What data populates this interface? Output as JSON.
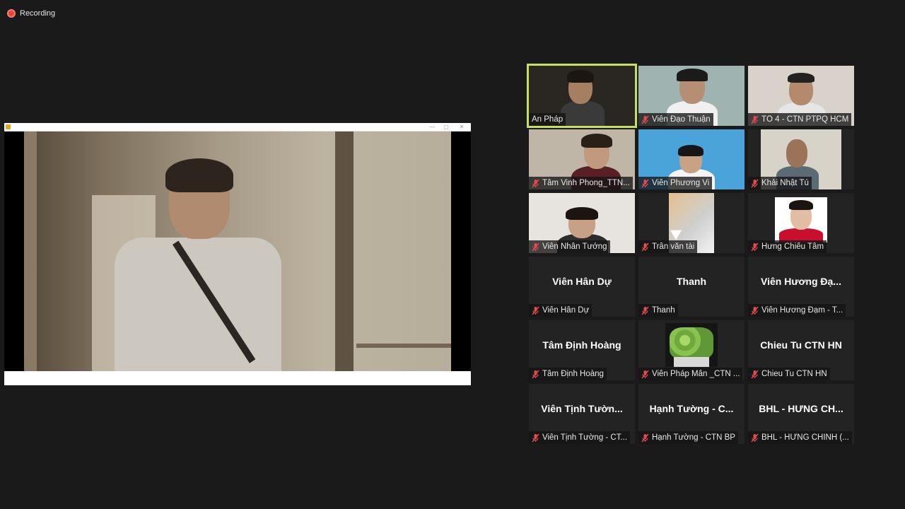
{
  "recording": {
    "label": "Recording",
    "color": "#e8443a"
  },
  "share": {
    "title_icon": "window-app-icon",
    "controls": [
      "—",
      "▢",
      "✕"
    ]
  },
  "gallery": {
    "active_border_color": "#c5e05a",
    "tiles": [
      {
        "name": "Ân Pháp",
        "muted": false,
        "video": true,
        "active": true
      },
      {
        "name": "Viên Đạo Thuận",
        "muted": true,
        "video": true
      },
      {
        "name": "TỔ 4 - CTN PTPQ HCM",
        "muted": true,
        "video": true
      },
      {
        "name": "Tâm Vinh Phong_TTN...",
        "muted": true,
        "video": true
      },
      {
        "name": "Viên Phương Vi",
        "muted": true,
        "video": true
      },
      {
        "name": "Khải Nhật Tú",
        "muted": true,
        "video": true
      },
      {
        "name": "Viên Nhân Tướng",
        "muted": true,
        "video": true
      },
      {
        "name": "Trần văn tài",
        "muted": true,
        "video": true
      },
      {
        "name": "Hưng Chiếu Tâm",
        "muted": true,
        "video": true
      },
      {
        "name": "Viên Hân Dự",
        "display": "Viên Hân Dự",
        "muted": true,
        "video": false
      },
      {
        "name": "Thanh",
        "display": "Thanh",
        "muted": true,
        "video": false
      },
      {
        "name": "Viên Hương Đạm - T...",
        "display": "Viên Hương Đạ...",
        "muted": true,
        "video": false
      },
      {
        "name": "Tâm Định Hoàng",
        "display": "Tâm Định Hoàng",
        "muted": true,
        "video": false
      },
      {
        "name": "Viên Pháp Mẫn _CTN ...",
        "muted": true,
        "video": true
      },
      {
        "name": "Chieu Tu CTN HN",
        "display": "Chieu Tu CTN HN",
        "muted": true,
        "video": false
      },
      {
        "name": "Viên Tịnh Tường - CT...",
        "display": "Viên Tịnh Tườn...",
        "muted": true,
        "video": false
      },
      {
        "name": "Hạnh Tường - CTN BP",
        "display": "Hạnh Tường - C...",
        "muted": true,
        "video": false
      },
      {
        "name": "BHL - HƯNG CHÍNH (...",
        "display": "BHL - HƯNG CH...",
        "muted": true,
        "video": false
      }
    ]
  }
}
